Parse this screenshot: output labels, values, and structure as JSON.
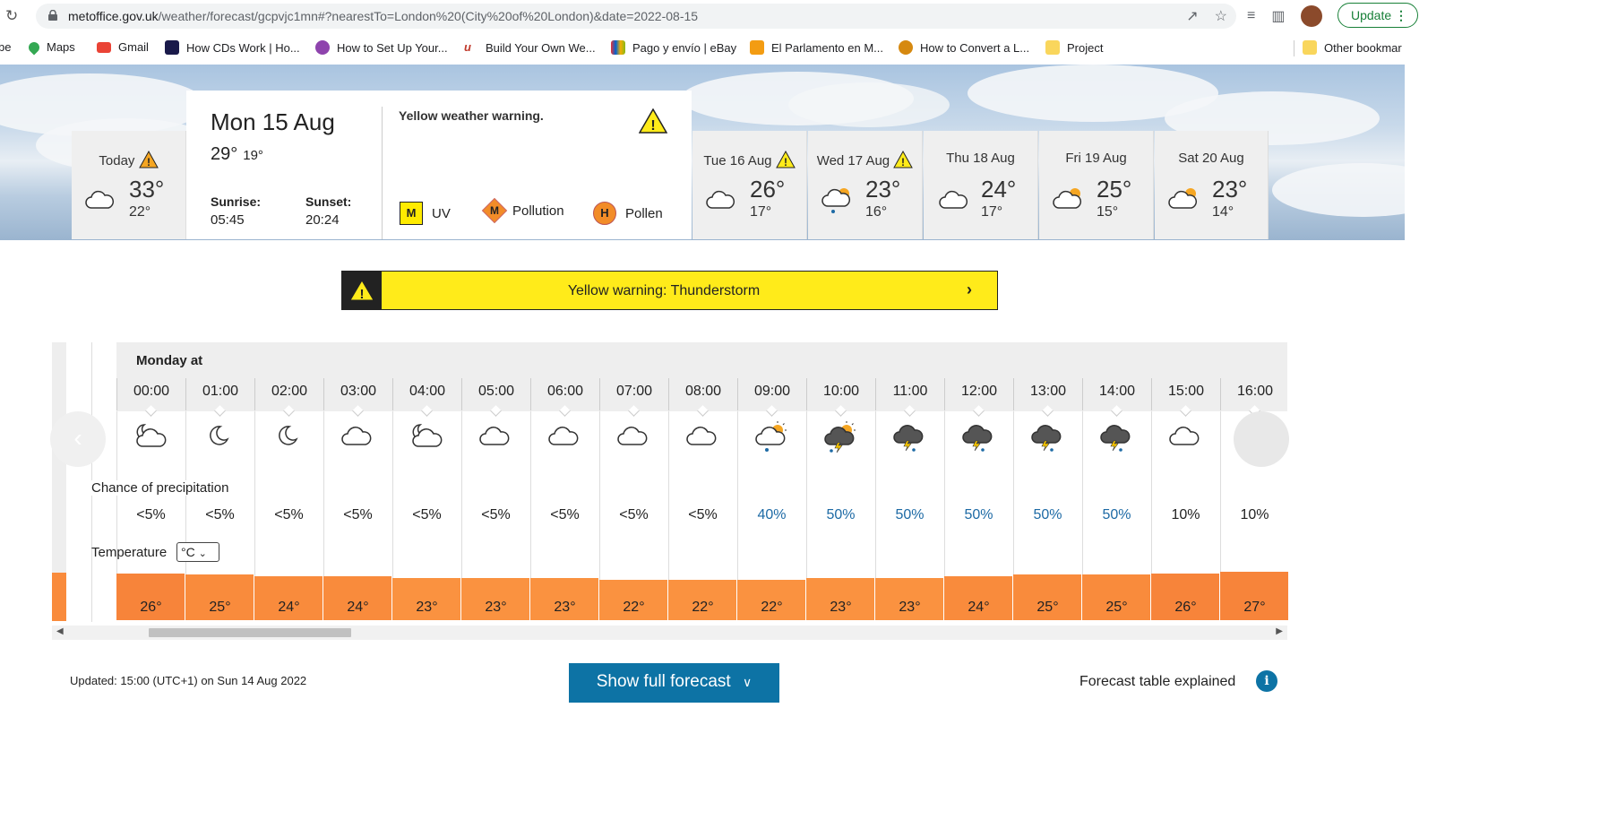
{
  "browser": {
    "url_host": "metoffice.gov.uk",
    "url_path": "/weather/forecast/gcpvjc1mn#?nearestTo=London%20(City%20of%20London)&date=2022-08-15",
    "update_label": "Update",
    "bookmarks": [
      {
        "label": "be"
      },
      {
        "label": "Maps"
      },
      {
        "label": "Gmail"
      },
      {
        "label": "How CDs Work | Ho..."
      },
      {
        "label": "How to Set Up Your..."
      },
      {
        "label": "Build Your Own We..."
      },
      {
        "label": "Pago y envío | eBay"
      },
      {
        "label": "El Parlamento en M..."
      },
      {
        "label": "How to Convert a L..."
      },
      {
        "label": "Project"
      },
      {
        "label": "Other bookmar"
      }
    ]
  },
  "days": [
    {
      "name": "Today",
      "hi": "33°",
      "lo": "22°",
      "warning": true,
      "icon": "cloud-icon"
    },
    {
      "name": "Tue 16 Aug",
      "hi": "26°",
      "lo": "17°",
      "warning": true,
      "icon": "cloud-icon"
    },
    {
      "name": "Wed 17 Aug",
      "hi": "23°",
      "lo": "16°",
      "warning": true,
      "icon": "sun-cloud-rain-icon"
    },
    {
      "name": "Thu 18 Aug",
      "hi": "24°",
      "lo": "17°",
      "warning": false,
      "icon": "cloud-icon"
    },
    {
      "name": "Fri 19 Aug",
      "hi": "25°",
      "lo": "15°",
      "warning": false,
      "icon": "sun-cloud-icon"
    },
    {
      "name": "Sat 20 Aug",
      "hi": "23°",
      "lo": "14°",
      "warning": false,
      "icon": "sun-cloud-icon"
    }
  ],
  "selected": {
    "date": "Mon 15 Aug",
    "hi": "29°",
    "lo": "19°",
    "sunrise_label": "Sunrise:",
    "sunrise": "05:45",
    "sunset_label": "Sunset:",
    "sunset": "20:24",
    "warning_text": "Yellow weather warning.",
    "uv_badge": "M",
    "uv_label": "UV",
    "pollution_badge": "M",
    "pollution_label": "Pollution",
    "pollen_badge": "H",
    "pollen_label": "Pollen"
  },
  "warning_banner": {
    "text": "Yellow warning: Thunderstorm"
  },
  "hourly": {
    "heading": "Monday at",
    "precip_label": "Chance of precipitation",
    "temp_label": "Temperature",
    "unit": "°C",
    "hours": [
      {
        "time": "00:00",
        "icon": "moon-cloud-icon",
        "precip": "<5%",
        "temp": "26°",
        "level": 26
      },
      {
        "time": "01:00",
        "icon": "moon-icon",
        "precip": "<5%",
        "temp": "25°",
        "level": 25
      },
      {
        "time": "02:00",
        "icon": "moon-icon",
        "precip": "<5%",
        "temp": "24°",
        "level": 24
      },
      {
        "time": "03:00",
        "icon": "cloud-icon",
        "precip": "<5%",
        "temp": "24°",
        "level": 24
      },
      {
        "time": "04:00",
        "icon": "moon-cloud-icon",
        "precip": "<5%",
        "temp": "23°",
        "level": 23
      },
      {
        "time": "05:00",
        "icon": "cloud-icon",
        "precip": "<5%",
        "temp": "23°",
        "level": 23
      },
      {
        "time": "06:00",
        "icon": "cloud-icon",
        "precip": "<5%",
        "temp": "23°",
        "level": 23
      },
      {
        "time": "07:00",
        "icon": "cloud-icon",
        "precip": "<5%",
        "temp": "22°",
        "level": 22
      },
      {
        "time": "08:00",
        "icon": "cloud-icon",
        "precip": "<5%",
        "temp": "22°",
        "level": 22
      },
      {
        "time": "09:00",
        "icon": "sun-cloud-rain-icon",
        "precip": "40%",
        "temp": "22°",
        "level": 22
      },
      {
        "time": "10:00",
        "icon": "sun-thunder-icon",
        "precip": "50%",
        "temp": "23°",
        "level": 23
      },
      {
        "time": "11:00",
        "icon": "thunder-icon",
        "precip": "50%",
        "temp": "23°",
        "level": 23
      },
      {
        "time": "12:00",
        "icon": "thunder-icon",
        "precip": "50%",
        "temp": "24°",
        "level": 24
      },
      {
        "time": "13:00",
        "icon": "thunder-icon",
        "precip": "50%",
        "temp": "25°",
        "level": 25
      },
      {
        "time": "14:00",
        "icon": "thunder-icon",
        "precip": "50%",
        "temp": "25°",
        "level": 25
      },
      {
        "time": "15:00",
        "icon": "cloud-icon",
        "precip": "10%",
        "temp": "26°",
        "level": 26
      },
      {
        "time": "16:00",
        "icon": "cloud-icon",
        "precip": "10%",
        "temp": "27°",
        "level": 27
      }
    ]
  },
  "footer": {
    "updated": "Updated: 15:00 (UTC+1) on Sun 14 Aug 2022",
    "show_label": "Show full forecast",
    "explained": "Forecast table explained"
  },
  "colors": {
    "warning_yellow": "#ffeb1a",
    "temp_orange": "#f98b3c",
    "brand_blue": "#0d73a5",
    "precip_blue": "#1d6aa5"
  }
}
